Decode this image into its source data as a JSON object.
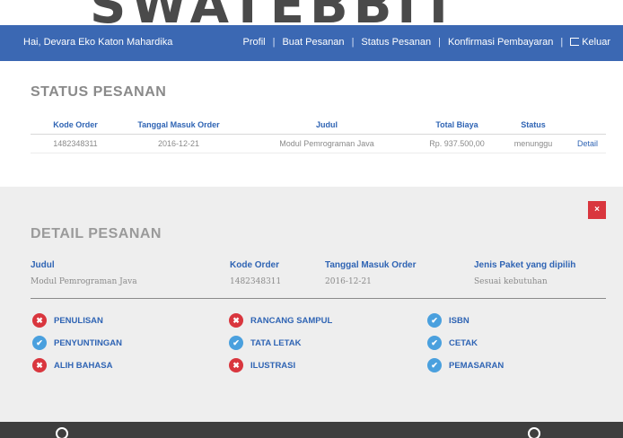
{
  "brand": {
    "logo_text": "SWATEBBIT"
  },
  "nav": {
    "greeting": "Hai, Devara Eko Katon Mahardika",
    "links": [
      "Profil",
      "Buat Pesanan",
      "Status Pesanan",
      "Konfirmasi Pembayaran"
    ],
    "separator": "|",
    "logout": "Keluar",
    "bar_color": "#3b68b3"
  },
  "status": {
    "title": "STATUS PESANAN",
    "columns": [
      "Kode Order",
      "Tanggal Masuk Order",
      "Judul",
      "Total Biaya",
      "Status",
      ""
    ],
    "rows": [
      {
        "kode": "1482348311",
        "tanggal": "2016-12-21",
        "judul": "Modul Pemrograman Java",
        "biaya": "Rp. 937.500,00",
        "status": "menunggu",
        "action": "Detail"
      }
    ]
  },
  "detail": {
    "title": "DETAIL PESANAN",
    "close_icon": "×",
    "fields": {
      "judul": {
        "label": "Judul",
        "value": "Modul Pemrograman Java"
      },
      "kode": {
        "label": "Kode Order",
        "value": "1482348311"
      },
      "tanggal": {
        "label": "Tanggal Masuk Order",
        "value": "2016-12-21"
      },
      "paket": {
        "label": "Jenis Paket yang dipilih",
        "value": "Sesuai kebutuhan"
      }
    },
    "services": [
      {
        "label": "PENULISAN",
        "included": false
      },
      {
        "label": "RANCANG SAMPUL",
        "included": false
      },
      {
        "label": "ISBN",
        "included": true
      },
      {
        "label": "PENYUNTINGAN",
        "included": true
      },
      {
        "label": "TATA LETAK",
        "included": true
      },
      {
        "label": "CETAK",
        "included": true
      },
      {
        "label": "ALIH BAHASA",
        "included": false
      },
      {
        "label": "ILUSTRASI",
        "included": false
      },
      {
        "label": "PEMASARAN",
        "included": true
      }
    ],
    "icon_yes": "✔",
    "icon_no": "✖",
    "color_yes": "#4aa0de",
    "color_no": "#d9363e"
  }
}
